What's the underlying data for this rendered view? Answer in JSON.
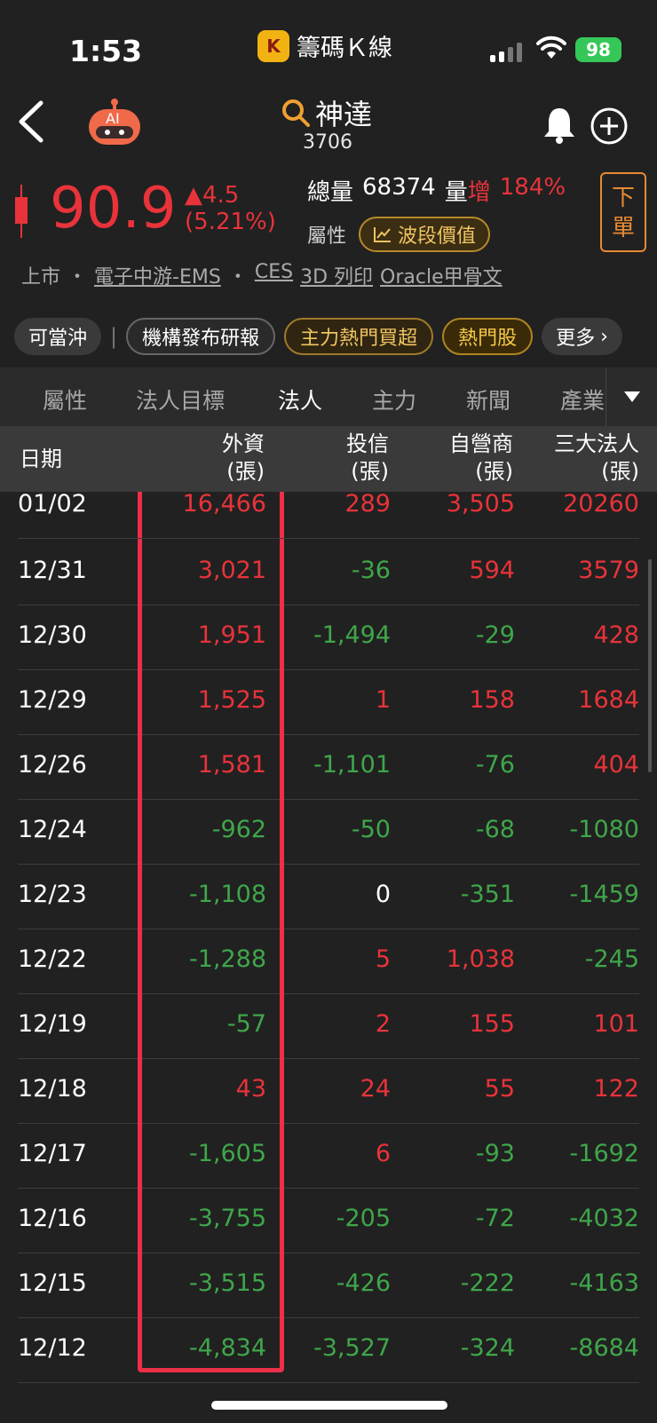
{
  "status_bar": {
    "time": "1:53",
    "battery": "98"
  },
  "app": {
    "name": "籌碼Ｋ線",
    "logo_letter": "K"
  },
  "header": {
    "stock_name": "神達",
    "stock_code": "3706",
    "ai_label": "AI"
  },
  "price": {
    "last": "90.9",
    "change": "▲4.5",
    "change_pct": "(5.21%)",
    "volume_label": "總量",
    "volume": "68374",
    "vol_change_label": "量",
    "vol_change_word": "增",
    "vol_change_pct": "184%",
    "attr_label": "屬性",
    "wave_button": "波段價值",
    "order_button_1": "下",
    "order_button_2": "單"
  },
  "tags": {
    "market": "上市",
    "sep": "・",
    "items": [
      "電子中游-EMS",
      "CES",
      "3D 列印",
      "Oracle甲骨文"
    ]
  },
  "chips": [
    "可當沖",
    "機構發布研報",
    "主力熱門買超",
    "熱門股",
    "更多"
  ],
  "tabs": [
    "屬性",
    "法人目標",
    "法人",
    "主力",
    "新聞",
    "產業"
  ],
  "table": {
    "headers": [
      {
        "line1": "日期",
        "line2": ""
      },
      {
        "line1": "外資",
        "line2": "(張)"
      },
      {
        "line1": "投信",
        "line2": "(張)"
      },
      {
        "line1": "自營商",
        "line2": "(張)"
      },
      {
        "line1": "三大法人",
        "line2": "(張)"
      }
    ],
    "rows": [
      [
        "01/02",
        "16,466",
        "289",
        "3,505",
        "20260"
      ],
      [
        "12/31",
        "3,021",
        "-36",
        "594",
        "3579"
      ],
      [
        "12/30",
        "1,951",
        "-1,494",
        "-29",
        "428"
      ],
      [
        "12/29",
        "1,525",
        "1",
        "158",
        "1684"
      ],
      [
        "12/26",
        "1,581",
        "-1,101",
        "-76",
        "404"
      ],
      [
        "12/24",
        "-962",
        "-50",
        "-68",
        "-1080"
      ],
      [
        "12/23",
        "-1,108",
        "0",
        "-351",
        "-1459"
      ],
      [
        "12/22",
        "-1,288",
        "5",
        "1,038",
        "-245"
      ],
      [
        "12/19",
        "-57",
        "2",
        "155",
        "101"
      ],
      [
        "12/18",
        "43",
        "24",
        "55",
        "122"
      ],
      [
        "12/17",
        "-1,605",
        "6",
        "-93",
        "-1692"
      ],
      [
        "12/16",
        "-3,755",
        "-205",
        "-72",
        "-4032"
      ],
      [
        "12/15",
        "-3,515",
        "-426",
        "-222",
        "-4163"
      ],
      [
        "12/12",
        "-4,834",
        "-3,527",
        "-324",
        "-8684"
      ]
    ]
  },
  "colors": {
    "up": "#e8333a",
    "down": "#3fa64a",
    "flat": "#ffffff",
    "highlight": "#ec2f49"
  }
}
